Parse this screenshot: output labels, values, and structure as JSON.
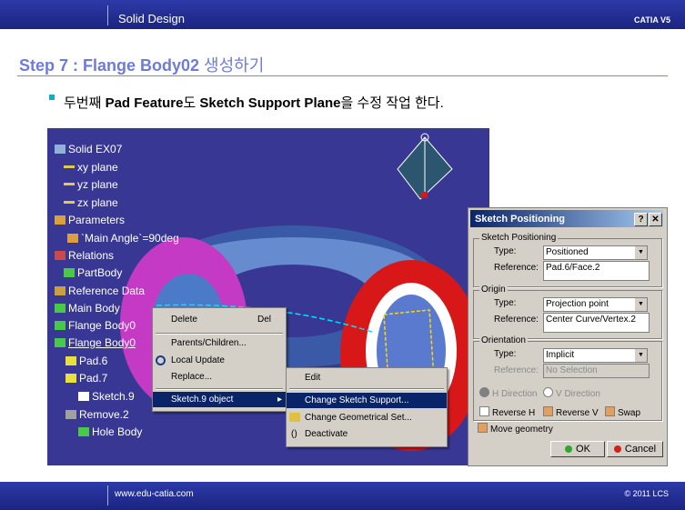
{
  "header": {
    "title": "Solid Design",
    "brand": "CATIA V5"
  },
  "step": {
    "title_en": "Step 7 : Flange Body02 ",
    "title_kr": "생성하기"
  },
  "bullet": {
    "p1": "두번째 ",
    "b1": "Pad Feature",
    "p2": "도 ",
    "b2": "Sketch Support Plane",
    "p3": "을 수정 작업 한다."
  },
  "tree": {
    "root": "Solid EX07",
    "xy": "xy plane",
    "yz": "yz plane",
    "zx": "zx plane",
    "parameters": "Parameters",
    "main_angle": "`Main Angle`=90deg",
    "relations": "Relations",
    "partbody": "PartBody",
    "refdata": "Reference Data",
    "mainbody": "Main Body",
    "flange1": "Flange Body0",
    "flange2": "Flange Body0",
    "pad6": "Pad.6",
    "pad7": "Pad.7",
    "sketch9": "Sketch.9",
    "remove2": "Remove.2",
    "hole": "Hole Body"
  },
  "context_menu": {
    "delete": "Delete",
    "delete_key": "Del",
    "parents": "Parents/Children...",
    "local_update": "Local Update",
    "replace": "Replace...",
    "sketch_object": "Sketch.9 object"
  },
  "submenu": {
    "edit": "Edit",
    "change_support": "Change Sketch Support...",
    "change_geoset": "Change Geometrical Set...",
    "deactivate": "Deactivate"
  },
  "dialog": {
    "title": "Sketch Positioning",
    "group_sp": "Sketch Positioning",
    "type_label": "Type:",
    "sp_type": "Positioned",
    "reference_label": "Reference:",
    "sp_reference": "Pad.6/Face.2",
    "group_origin": "Origin",
    "origin_type": "Projection point",
    "origin_reference": "Center Curve/Vertex.2",
    "group_orientation": "Orientation",
    "orient_type": "Implicit",
    "orient_reference": "No Selection",
    "h_direction": "H Direction",
    "v_direction": "V Direction",
    "reverse_h": "Reverse H",
    "reverse_v": "Reverse V",
    "swap": "Swap",
    "move_geometry": "Move geometry",
    "ok": "OK",
    "cancel": "Cancel"
  },
  "footer": {
    "url": "www.edu-catia.com",
    "copyright": "© 2011 LCS"
  }
}
